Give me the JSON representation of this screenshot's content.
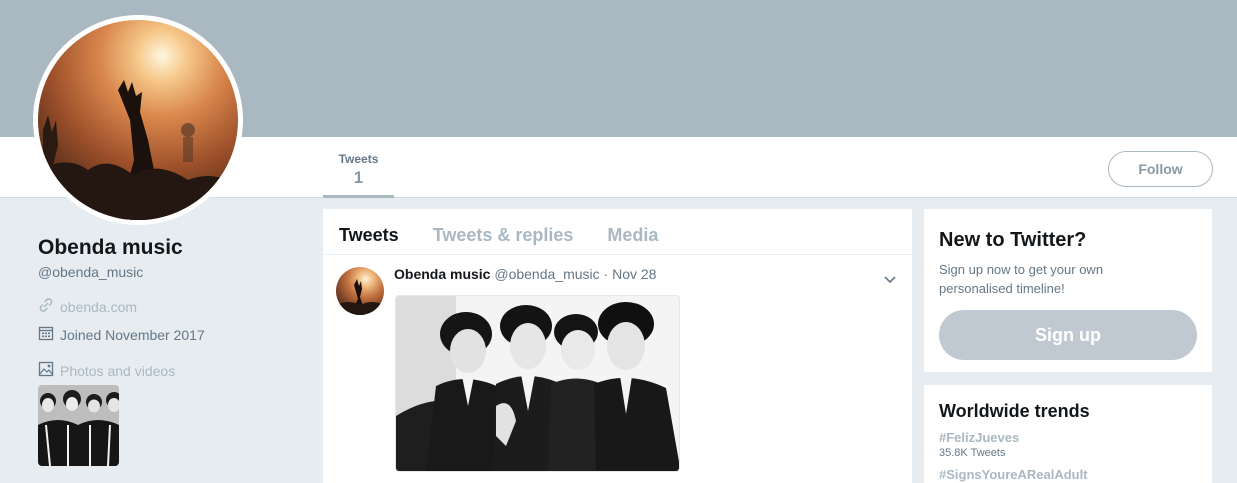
{
  "profile": {
    "name": "Obenda music",
    "handle": "@obenda_music",
    "website": "obenda.com",
    "joined": "Joined November 2017",
    "photos_label": "Photos and videos"
  },
  "nav": {
    "tweets_label": "Tweets",
    "tweets_count": "1",
    "follow_label": "Follow"
  },
  "timeline": {
    "tabs": [
      {
        "label": "Tweets"
      },
      {
        "label": "Tweets & replies"
      },
      {
        "label": "Media"
      }
    ],
    "tweet": {
      "author_name": "Obenda music",
      "author_handle": "@obenda_music",
      "date": "· Nov 28"
    }
  },
  "signup_card": {
    "title": "New to Twitter?",
    "subtitle": "Sign up now to get your own personalised timeline!",
    "button": "Sign up"
  },
  "trends": {
    "title": "Worldwide trends",
    "items": [
      {
        "tag": "#FelizJueves",
        "count": "35.8K Tweets"
      },
      {
        "tag": "#SignsYoureARealAdult",
        "count": ""
      }
    ]
  },
  "colors": {
    "banner": "#aab8c2",
    "background": "#e6ecf0",
    "muted_text": "#657786",
    "faint_text": "#aab8c2"
  },
  "icons": [
    "link-icon",
    "calendar-icon",
    "photo-icon",
    "chevron-down-icon"
  ]
}
